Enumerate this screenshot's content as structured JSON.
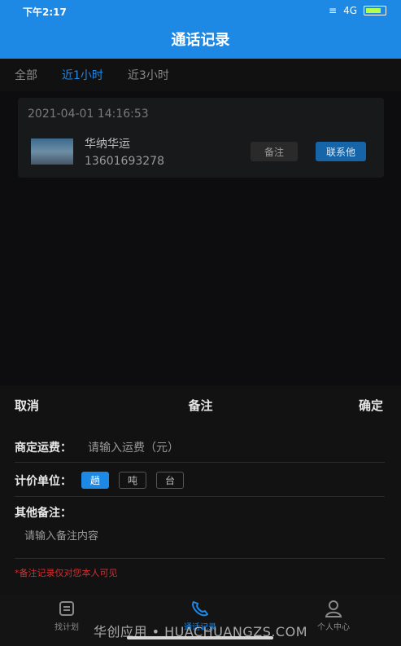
{
  "status": {
    "time": "下午2:17",
    "network": "4G"
  },
  "header": {
    "title": "通话记录"
  },
  "tabs": [
    {
      "label": "全部",
      "active": false
    },
    {
      "label": "近1小时",
      "active": true
    },
    {
      "label": "近3小时",
      "active": false
    }
  ],
  "record": {
    "timestamp": "2021-04-01 14:16:53",
    "name": "华纳华运",
    "phone": "13601693278",
    "note_button": "备注",
    "contact_button": "联系他"
  },
  "sheet": {
    "cancel": "取消",
    "title": "备注",
    "confirm": "确定",
    "freight_label": "商定运费：",
    "freight_placeholder": "请输入运费（元）",
    "unit_label": "计价单位：",
    "units": [
      "趟",
      "吨",
      "台"
    ],
    "selected_unit": "趟",
    "other_label": "其他备注：",
    "other_placeholder": "请输入备注内容",
    "warning": "*备注记录仅对您本人可见"
  },
  "nav": [
    {
      "label": "找计划",
      "icon": "list-icon",
      "active": false
    },
    {
      "label": "通话记录",
      "icon": "phone-icon",
      "active": true
    },
    {
      "label": "个人中心",
      "icon": "user-icon",
      "active": false
    }
  ],
  "watermark": "华创应用 • HUACHUANGZS.COM",
  "colors": {
    "primary": "#1e88e5",
    "warning": "#d32f2f"
  }
}
